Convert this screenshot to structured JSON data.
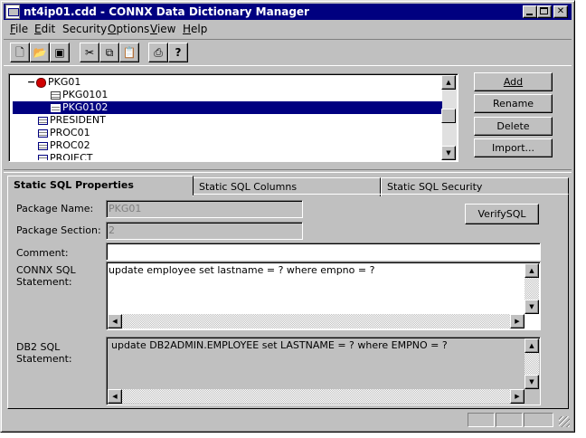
{
  "window": {
    "title": "nt4ip01.cdd - CONNX Data Dictionary Manager"
  },
  "menu": [
    "File",
    "Edit",
    "Security",
    "Options",
    "View",
    "Help"
  ],
  "menu_underline": [
    "F",
    "E",
    "",
    "O",
    "V",
    "H"
  ],
  "toolbar": [
    "new-icon",
    "open-icon",
    "save-icon",
    "cut-icon",
    "copy-icon",
    "paste-icon",
    "print-icon",
    "help-icon"
  ],
  "tree": {
    "items": [
      {
        "label": "PKG01",
        "icon": "package-icon",
        "expanded": true
      },
      {
        "label": "PKG0101",
        "icon": "table-icon"
      },
      {
        "label": "PKG0102",
        "icon": "table-icon",
        "selected": true
      },
      {
        "label": "PRESIDENT",
        "icon": "table-icon"
      },
      {
        "label": "PROC01",
        "icon": "table-icon"
      },
      {
        "label": "PROC02",
        "icon": "table-icon"
      },
      {
        "label": "PROJECT",
        "icon": "table-icon"
      }
    ],
    "expander": "−"
  },
  "side_buttons": {
    "add": "Add",
    "rename": "Rename",
    "delete": "Delete",
    "import": "Import..."
  },
  "tabs": {
    "active": "Static SQL Properties",
    "columns": "Static SQL Columns",
    "security": "Static SQL Security"
  },
  "form": {
    "package_name_label": "Package Name:",
    "package_name": "PKG01",
    "package_section_label": "Package Section:",
    "package_section": "2",
    "verify_button": "VerifySQL",
    "comment_label": "Comment:",
    "comment": "",
    "connx_sql_label_1": "CONNX SQL",
    "connx_sql_label_2": "Statement:",
    "connx_sql": "update employee set lastname = ? where empno = ?",
    "db2_sql_label_1": "DB2 SQL",
    "db2_sql_label_2": "Statement:",
    "db2_sql": "update  DB2ADMIN.EMPLOYEE  set  LASTNAME = ?  where  EMPNO = ?"
  }
}
